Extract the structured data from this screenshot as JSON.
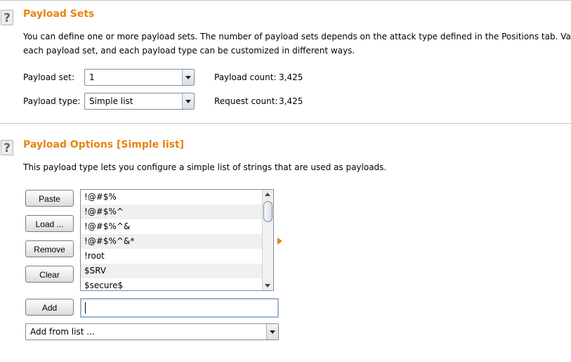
{
  "payload_sets": {
    "help_icon": "question-mark-icon",
    "title": "Payload Sets",
    "description_line1": "You can define one or more payload sets. The number of payload sets depends on the attack type defined in the Positions tab. Various",
    "description_line2": "each payload set, and each payload type can be customized in different ways.",
    "payload_set_label": "Payload set:",
    "payload_set_value": "1",
    "payload_type_label": "Payload type:",
    "payload_type_value": "Simple list",
    "payload_count_label": "Payload count:",
    "payload_count_value": "3,425",
    "request_count_label": "Request count:",
    "request_count_value": "3,425"
  },
  "payload_options": {
    "help_icon": "question-mark-icon",
    "title": "Payload Options [Simple list]",
    "description": "This payload type lets you configure a simple list of strings that are used as payloads.",
    "buttons": {
      "paste": "Paste",
      "load": "Load ...",
      "remove": "Remove",
      "clear": "Clear",
      "add": "Add"
    },
    "list_items": [
      "!@#$%",
      "!@#$%^",
      "!@#$%^&",
      "!@#$%^&*",
      "!root",
      "$SRV",
      "$secure$"
    ],
    "add_input_value": "",
    "add_from_list_value": "Add from list ..."
  },
  "colors": {
    "accent": "#e8830e",
    "row_alt": "#f0f0f0"
  }
}
